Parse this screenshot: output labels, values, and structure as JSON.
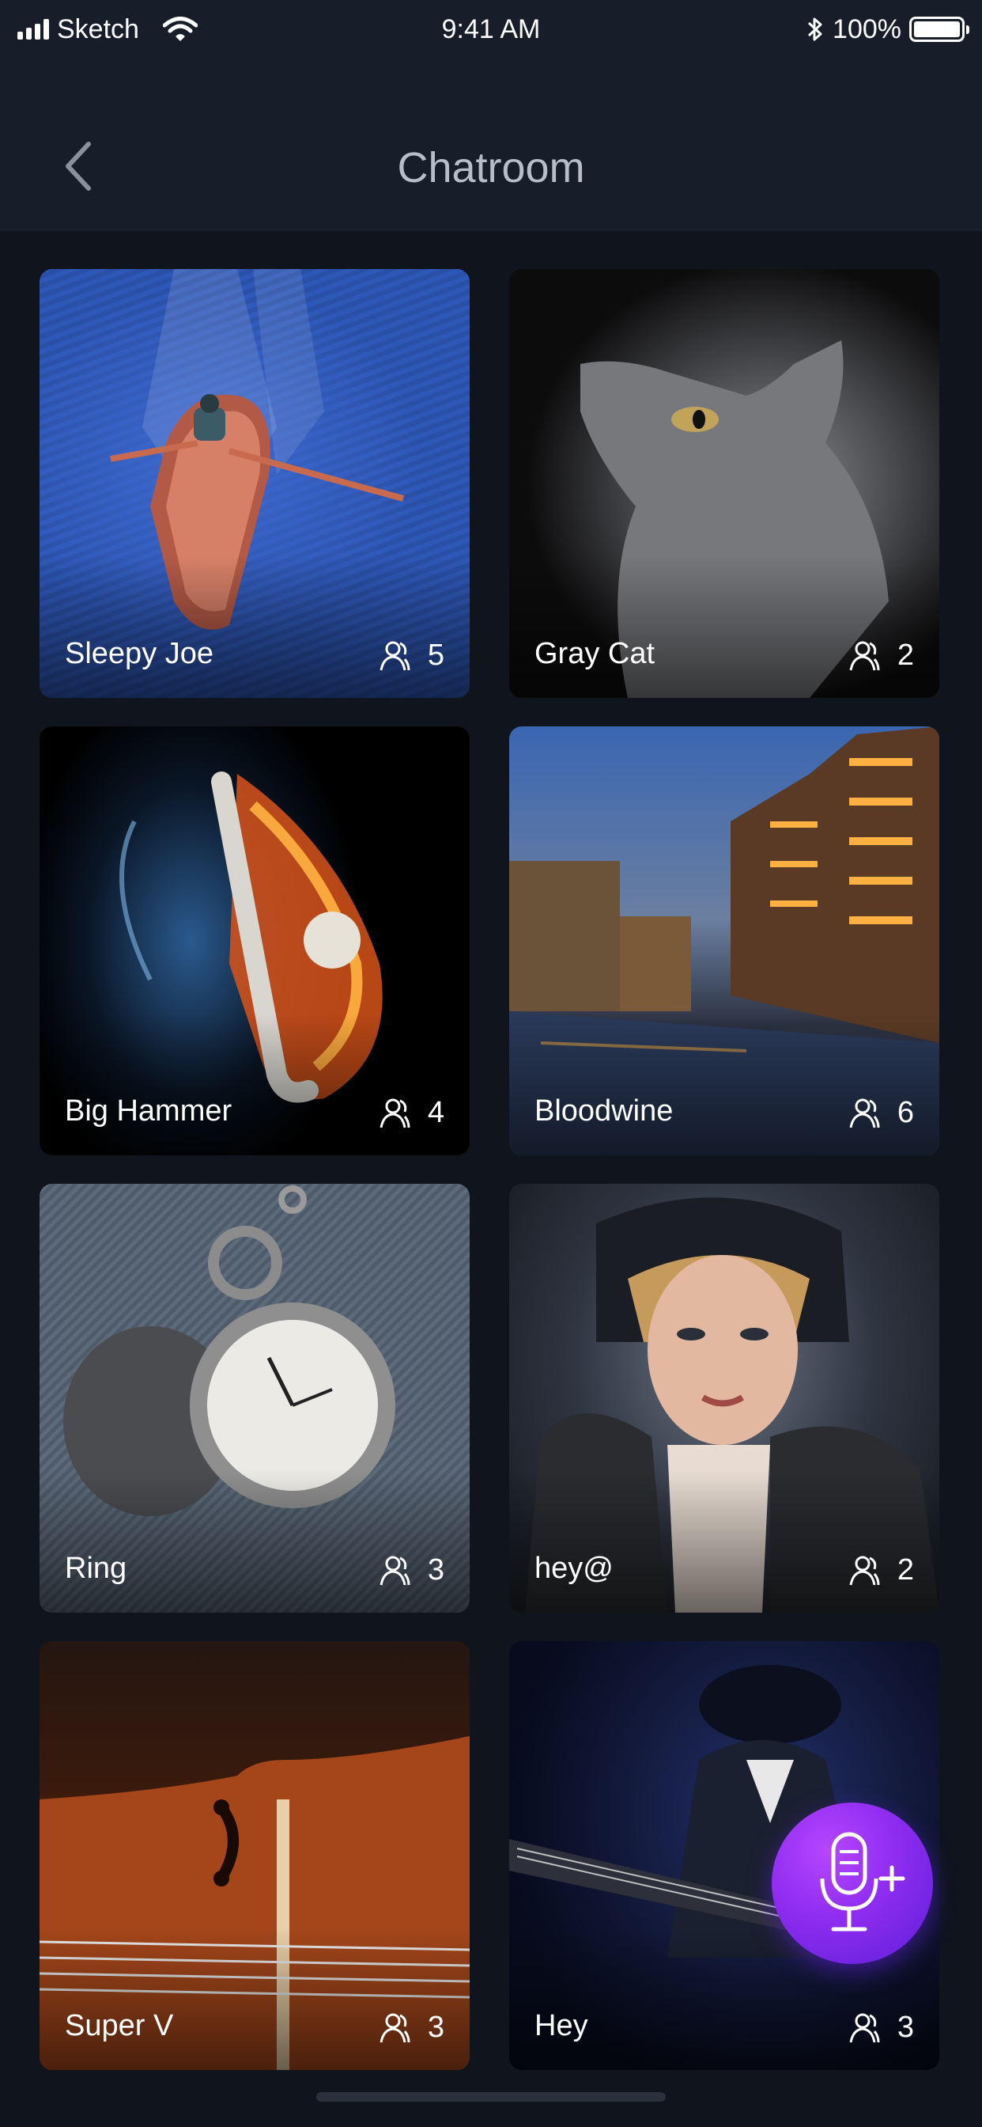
{
  "status_bar": {
    "carrier": "Sketch",
    "time": "9:41 AM",
    "battery": "100%"
  },
  "nav": {
    "title": "Chatroom"
  },
  "rooms": [
    {
      "name": "Sleepy Joe",
      "count": "5"
    },
    {
      "name": "Gray Cat",
      "count": "2"
    },
    {
      "name": "Big Hammer",
      "count": "4"
    },
    {
      "name": "Bloodwine",
      "count": "6"
    },
    {
      "name": "Ring",
      "count": "3"
    },
    {
      "name": "hey@",
      "count": "2"
    },
    {
      "name": "Super V",
      "count": "3"
    },
    {
      "name": "Hey",
      "count": "3"
    }
  ],
  "icons": {
    "back": "chevron-left-icon",
    "members": "person-icon",
    "fab": "microphone-plus-icon"
  },
  "colors": {
    "background": "#0f141d",
    "header": "#171d29",
    "fab_accent": "#8e2cf0"
  }
}
